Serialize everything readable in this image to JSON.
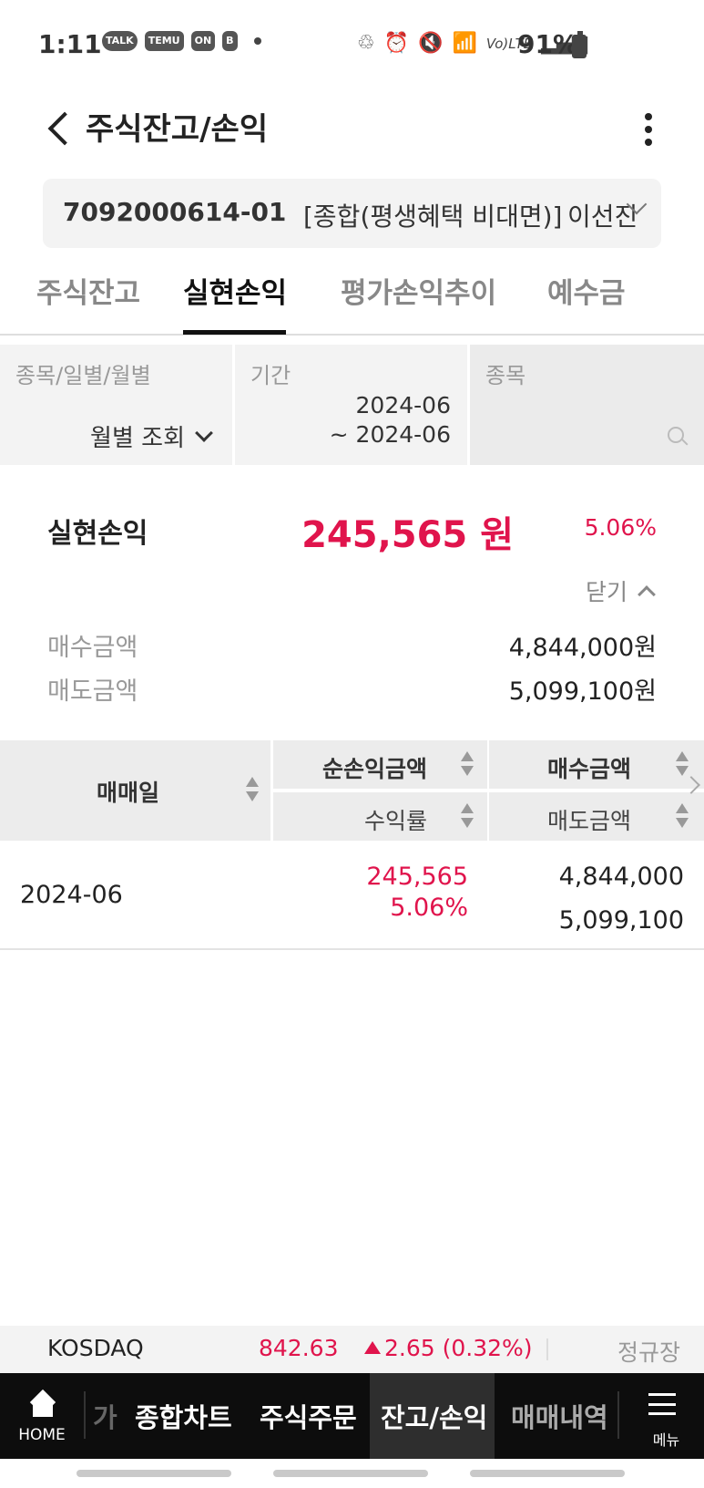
{
  "status_bar": {
    "time": "1:11",
    "apps": [
      "TALK",
      "TEMU",
      "ON",
      "B"
    ],
    "battery_percent": "91%",
    "icons": [
      "battery-saver-icon",
      "alarm-icon",
      "mute-icon",
      "wifi-icon",
      "volte-icon",
      "signal-icon",
      "battery-icon"
    ],
    "volte_label": "Vo)LTE"
  },
  "header": {
    "title": "주식잔고/손익"
  },
  "account": {
    "number": "7092000614-01",
    "type": "[종합(평생혜택 비대면)]",
    "name": "이선진"
  },
  "tabs": [
    {
      "label": "주식잔고",
      "active": false
    },
    {
      "label": "실현손익",
      "active": true
    },
    {
      "label": "평가손익추이",
      "active": false
    },
    {
      "label": "예수금",
      "active": false
    }
  ],
  "filters": {
    "view_label": "종목/일별/월별",
    "view_value": "월별 조회",
    "period_label": "기간",
    "period_from": "2024-06",
    "period_to": "~ 2024-06",
    "stock_label": "종목"
  },
  "summary": {
    "label": "실현손익",
    "amount": "245,565 원",
    "rate": "5.06%",
    "close_label": "닫기",
    "buy_label": "매수금액",
    "buy_value": "4,844,000원",
    "sell_label": "매도금액",
    "sell_value": "5,099,100원"
  },
  "table": {
    "headers": {
      "date": "매매일",
      "net_pnl": "순손익금액",
      "rate": "수익률",
      "buy": "매수금액",
      "sell": "매도금액"
    },
    "rows": [
      {
        "date": "2024-06",
        "net_pnl": "245,565",
        "rate": "5.06%",
        "buy": "4,844,000",
        "sell": "5,099,100"
      }
    ]
  },
  "ticker": {
    "name": "KOSDAQ",
    "value": "842.63",
    "change": "2.65 (0.32%)",
    "direction": "up",
    "session": "정규장"
  },
  "bottom_nav": {
    "home": "HOME",
    "items": [
      "가",
      "종합차트",
      "주식주문",
      "잔고/손익",
      "매매내역"
    ],
    "active": "잔고/손익",
    "menu": "메뉴"
  },
  "colors": {
    "accent_red": "#e0144c",
    "nav_bg": "#0d0d0d",
    "panel_bg": "#f3f3f3"
  }
}
